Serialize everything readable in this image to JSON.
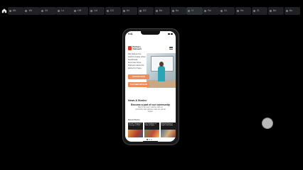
{
  "browser": {
    "tabs": [
      "Wt",
      "Wt",
      "Bt",
      "Lo",
      "HR",
      "Ud",
      "D2",
      "ttt",
      "D2",
      "Ba",
      "Ba",
      "H",
      "Re",
      "Dr",
      "Re",
      "ZL",
      "Be",
      "Ba"
    ],
    "active_tab_index": 11,
    "new_tab_label": "+"
  },
  "phone": {
    "status": {
      "time": "9:41"
    },
    "header": {
      "logo_text": "Partners Outreach"
    },
    "hero": {
      "text": "We believe the world is better when heartbreak becomes hope. Partners bless the planet for hope."
    },
    "buttons": {
      "primary": "DONATE NOW",
      "secondary": "PARTNER WITH US"
    },
    "news": {
      "title": "News & Stories",
      "cta": "Become a part of our community",
      "subtitle": "Stay in our loop in partner with our community help partners make an eternal impact.",
      "recent_label": "Recent Stories",
      "cards": [
        "Growth, Support & Courage in 2024",
        "Joy Overflows at Year of Sights",
        "Bringing Hope in Sight and Health"
      ]
    }
  },
  "colors": {
    "accent": "#f08c5a",
    "logo": "#d8452f",
    "background": "#000000"
  }
}
